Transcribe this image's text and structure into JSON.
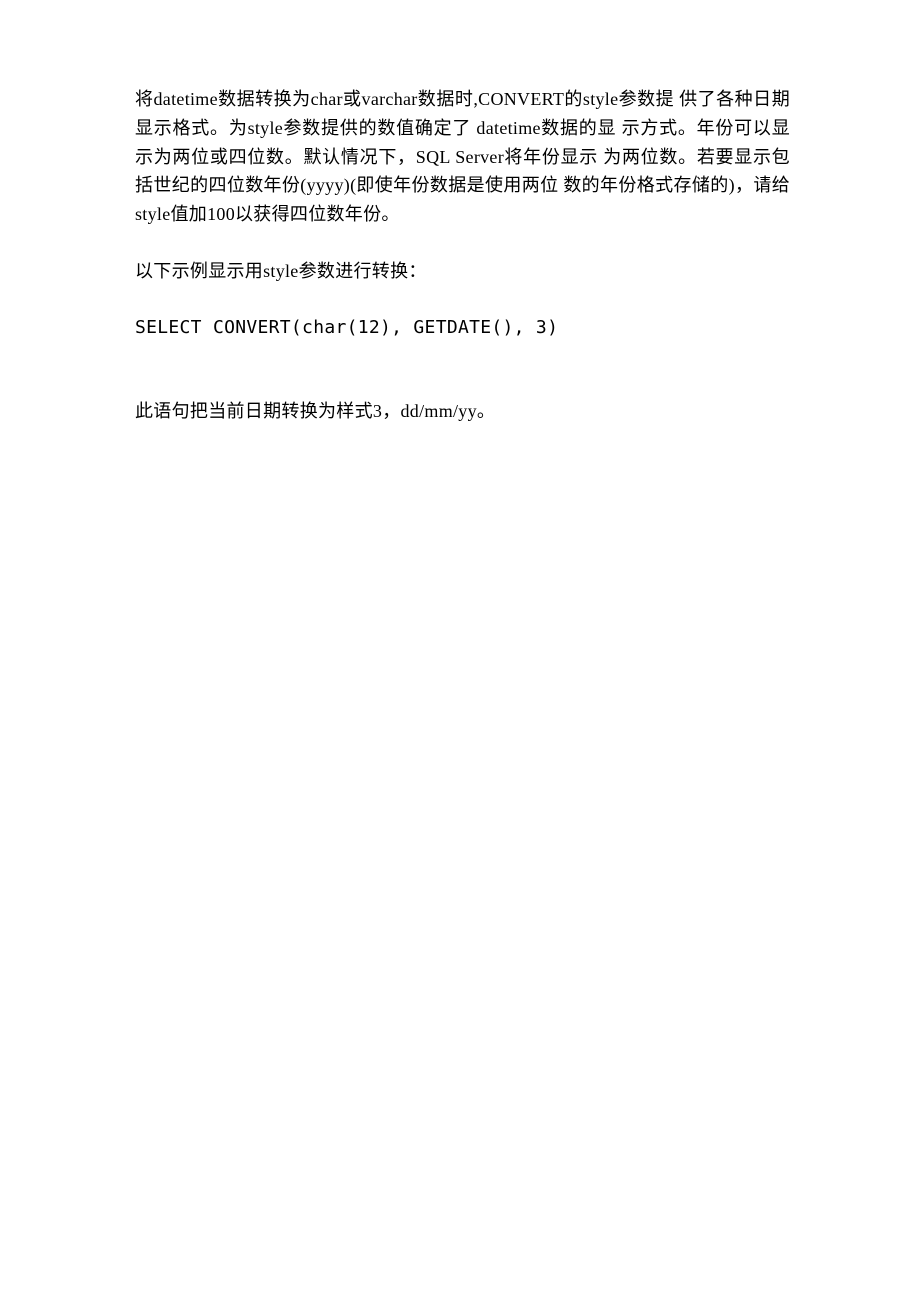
{
  "paragraphs": {
    "p1": "将datetime数据转换为char或varchar数据时,CONVERT的style参数提 供了各种日期显示格式。为style参数提供的数值确定了 datetime数据的显 示方式。年份可以显示为两位或四位数。默认情况下，SQL Server将年份显示 为两位数。若要显示包括世纪的四位数年份(yyyy)(即使年份数据是使用两位 数的年份格式存储的)，请给style值加100以获得四位数年份。",
    "p2": "以下示例显示用style参数进行转换：",
    "p3": "SELECT CONVERT(char(12), GETDATE(), 3)",
    "p4": "此语句把当前日期转换为样式3，dd/mm/yy。"
  }
}
